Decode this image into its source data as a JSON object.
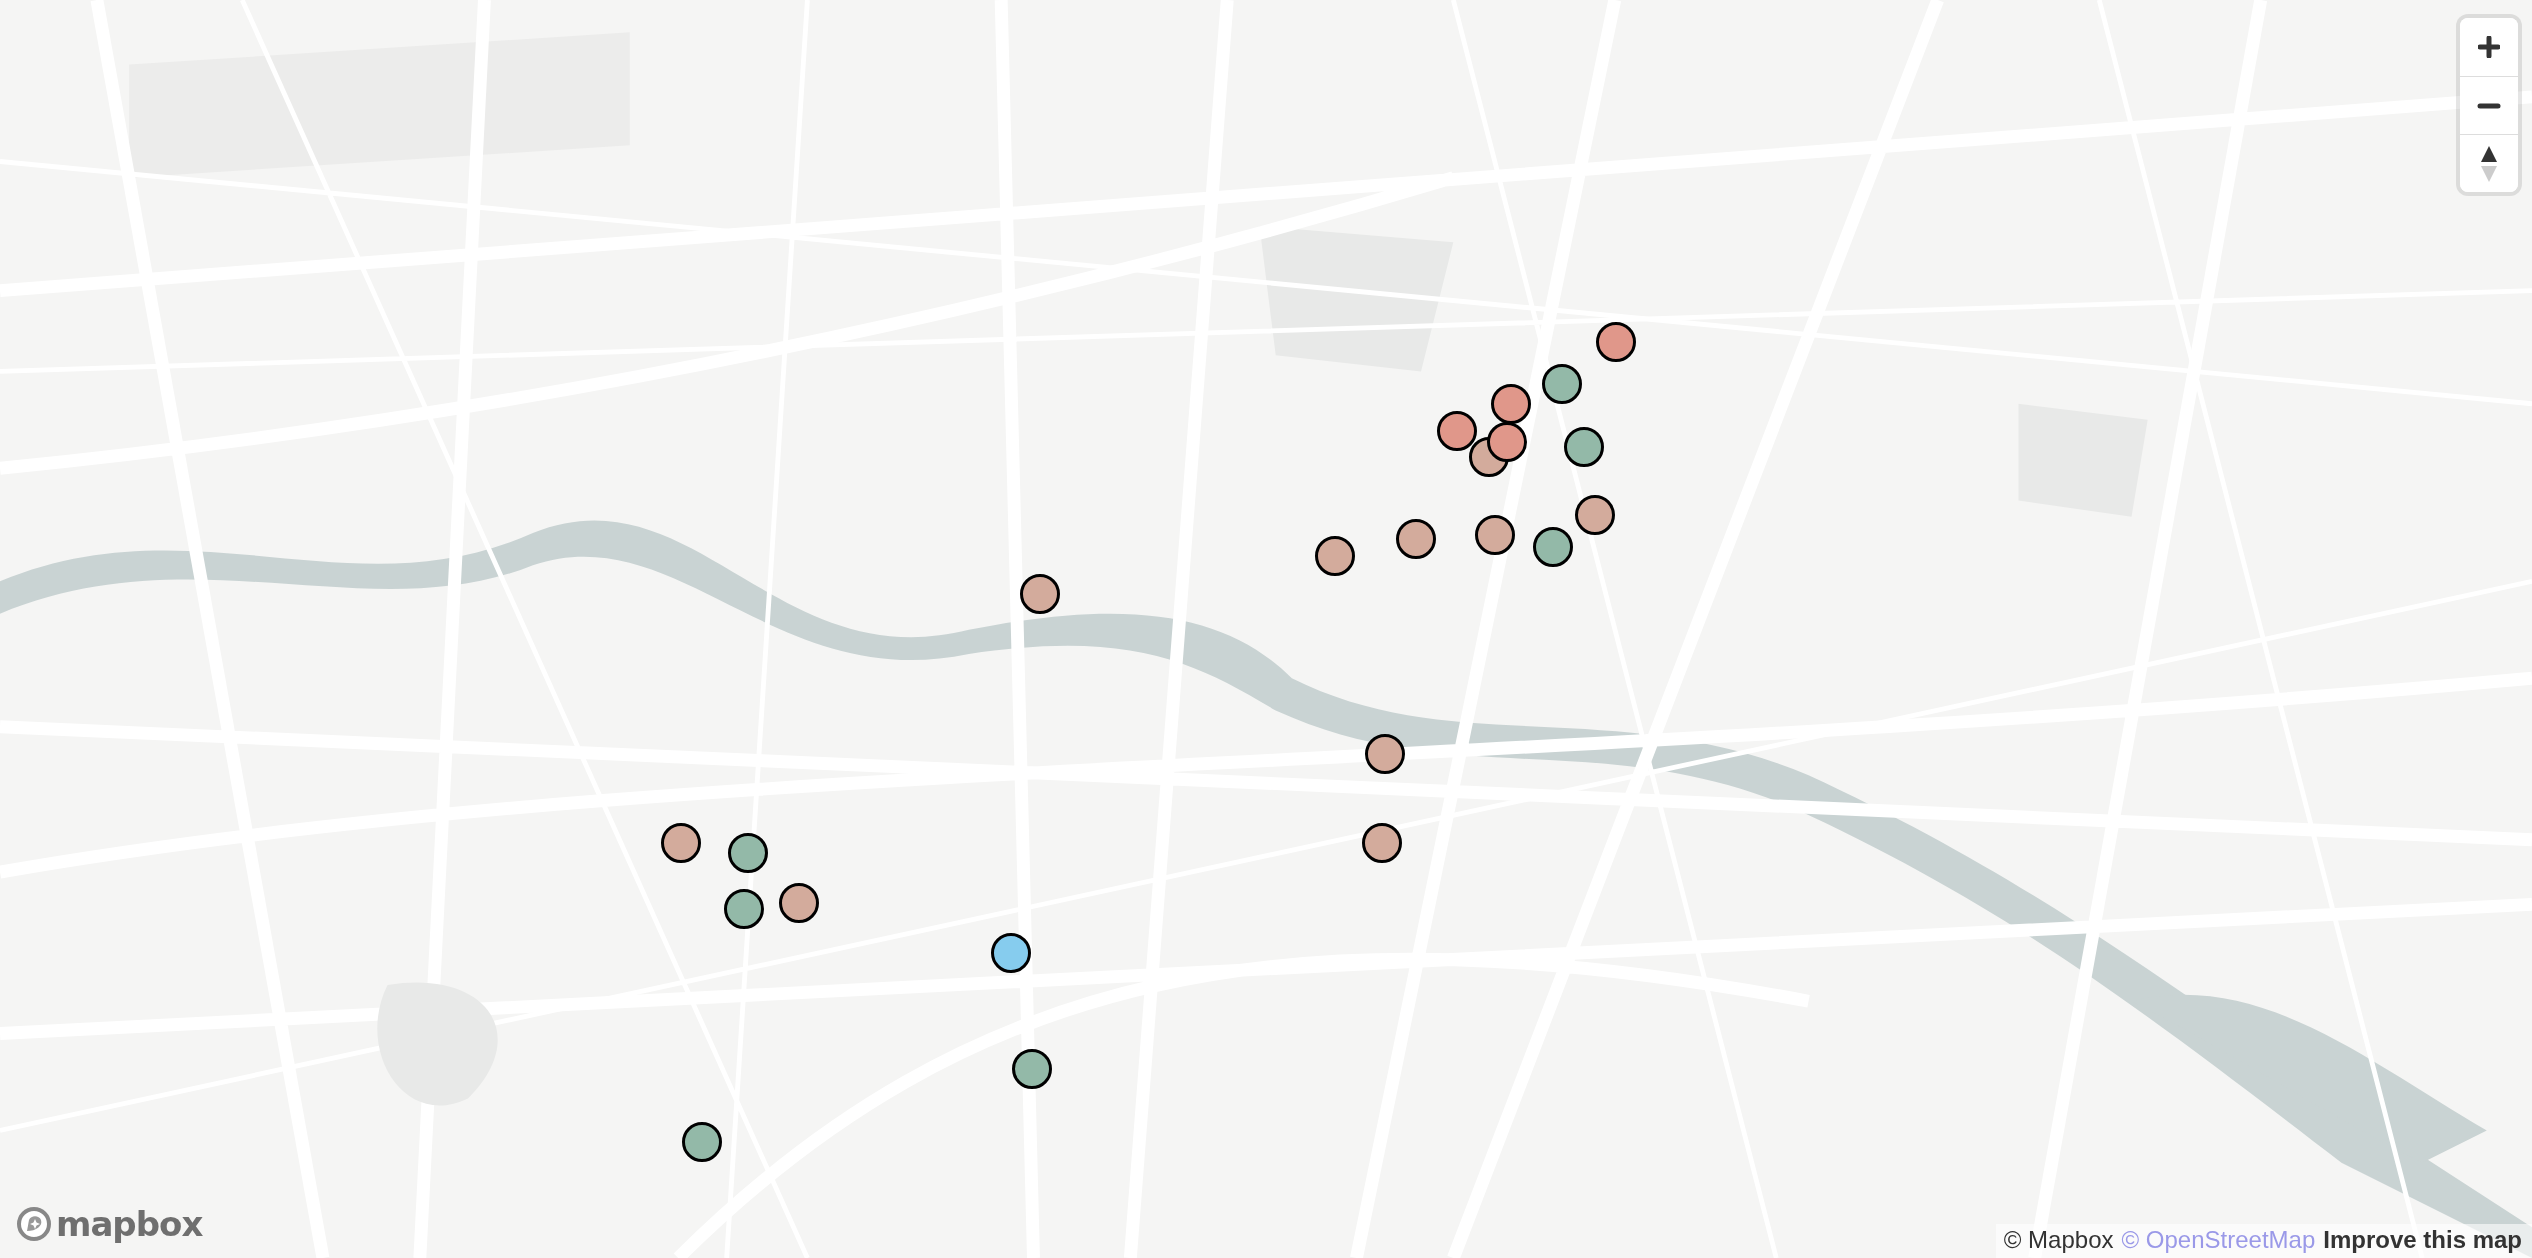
{
  "markers": [
    {
      "color": "#e0978a"
    },
    {
      "color": "#d3ab9c"
    },
    {
      "color": "#93b9a8"
    },
    {
      "color": "#e0978a"
    },
    {
      "color": "#e0978a"
    },
    {
      "color": "#e0978a"
    },
    {
      "color": "#93b9a8"
    },
    {
      "color": "#d3ab9c"
    },
    {
      "color": "#d3ab9c"
    },
    {
      "color": "#d3ab9c"
    },
    {
      "color": "#93b9a8"
    },
    {
      "color": "#d3ab9c"
    },
    {
      "color": "#d3ab9c"
    },
    {
      "color": "#d3ab9c"
    },
    {
      "color": "#d3ab9c"
    },
    {
      "color": "#d3ab9c"
    },
    {
      "color": "#93b9a8"
    },
    {
      "color": "#d3ab9c"
    },
    {
      "color": "#93b9a8"
    },
    {
      "color": "#86ccee"
    },
    {
      "color": "#93b9a8"
    },
    {
      "color": "#93b9a8"
    }
  ],
  "logo": {
    "text": "mapbox"
  },
  "attribution": [
    {
      "text": "© Mapbox",
      "kind": "plain"
    },
    {
      "text": "© OpenStreetMap",
      "kind": "link"
    },
    {
      "text": "Improve this map",
      "kind": "strong"
    }
  ]
}
